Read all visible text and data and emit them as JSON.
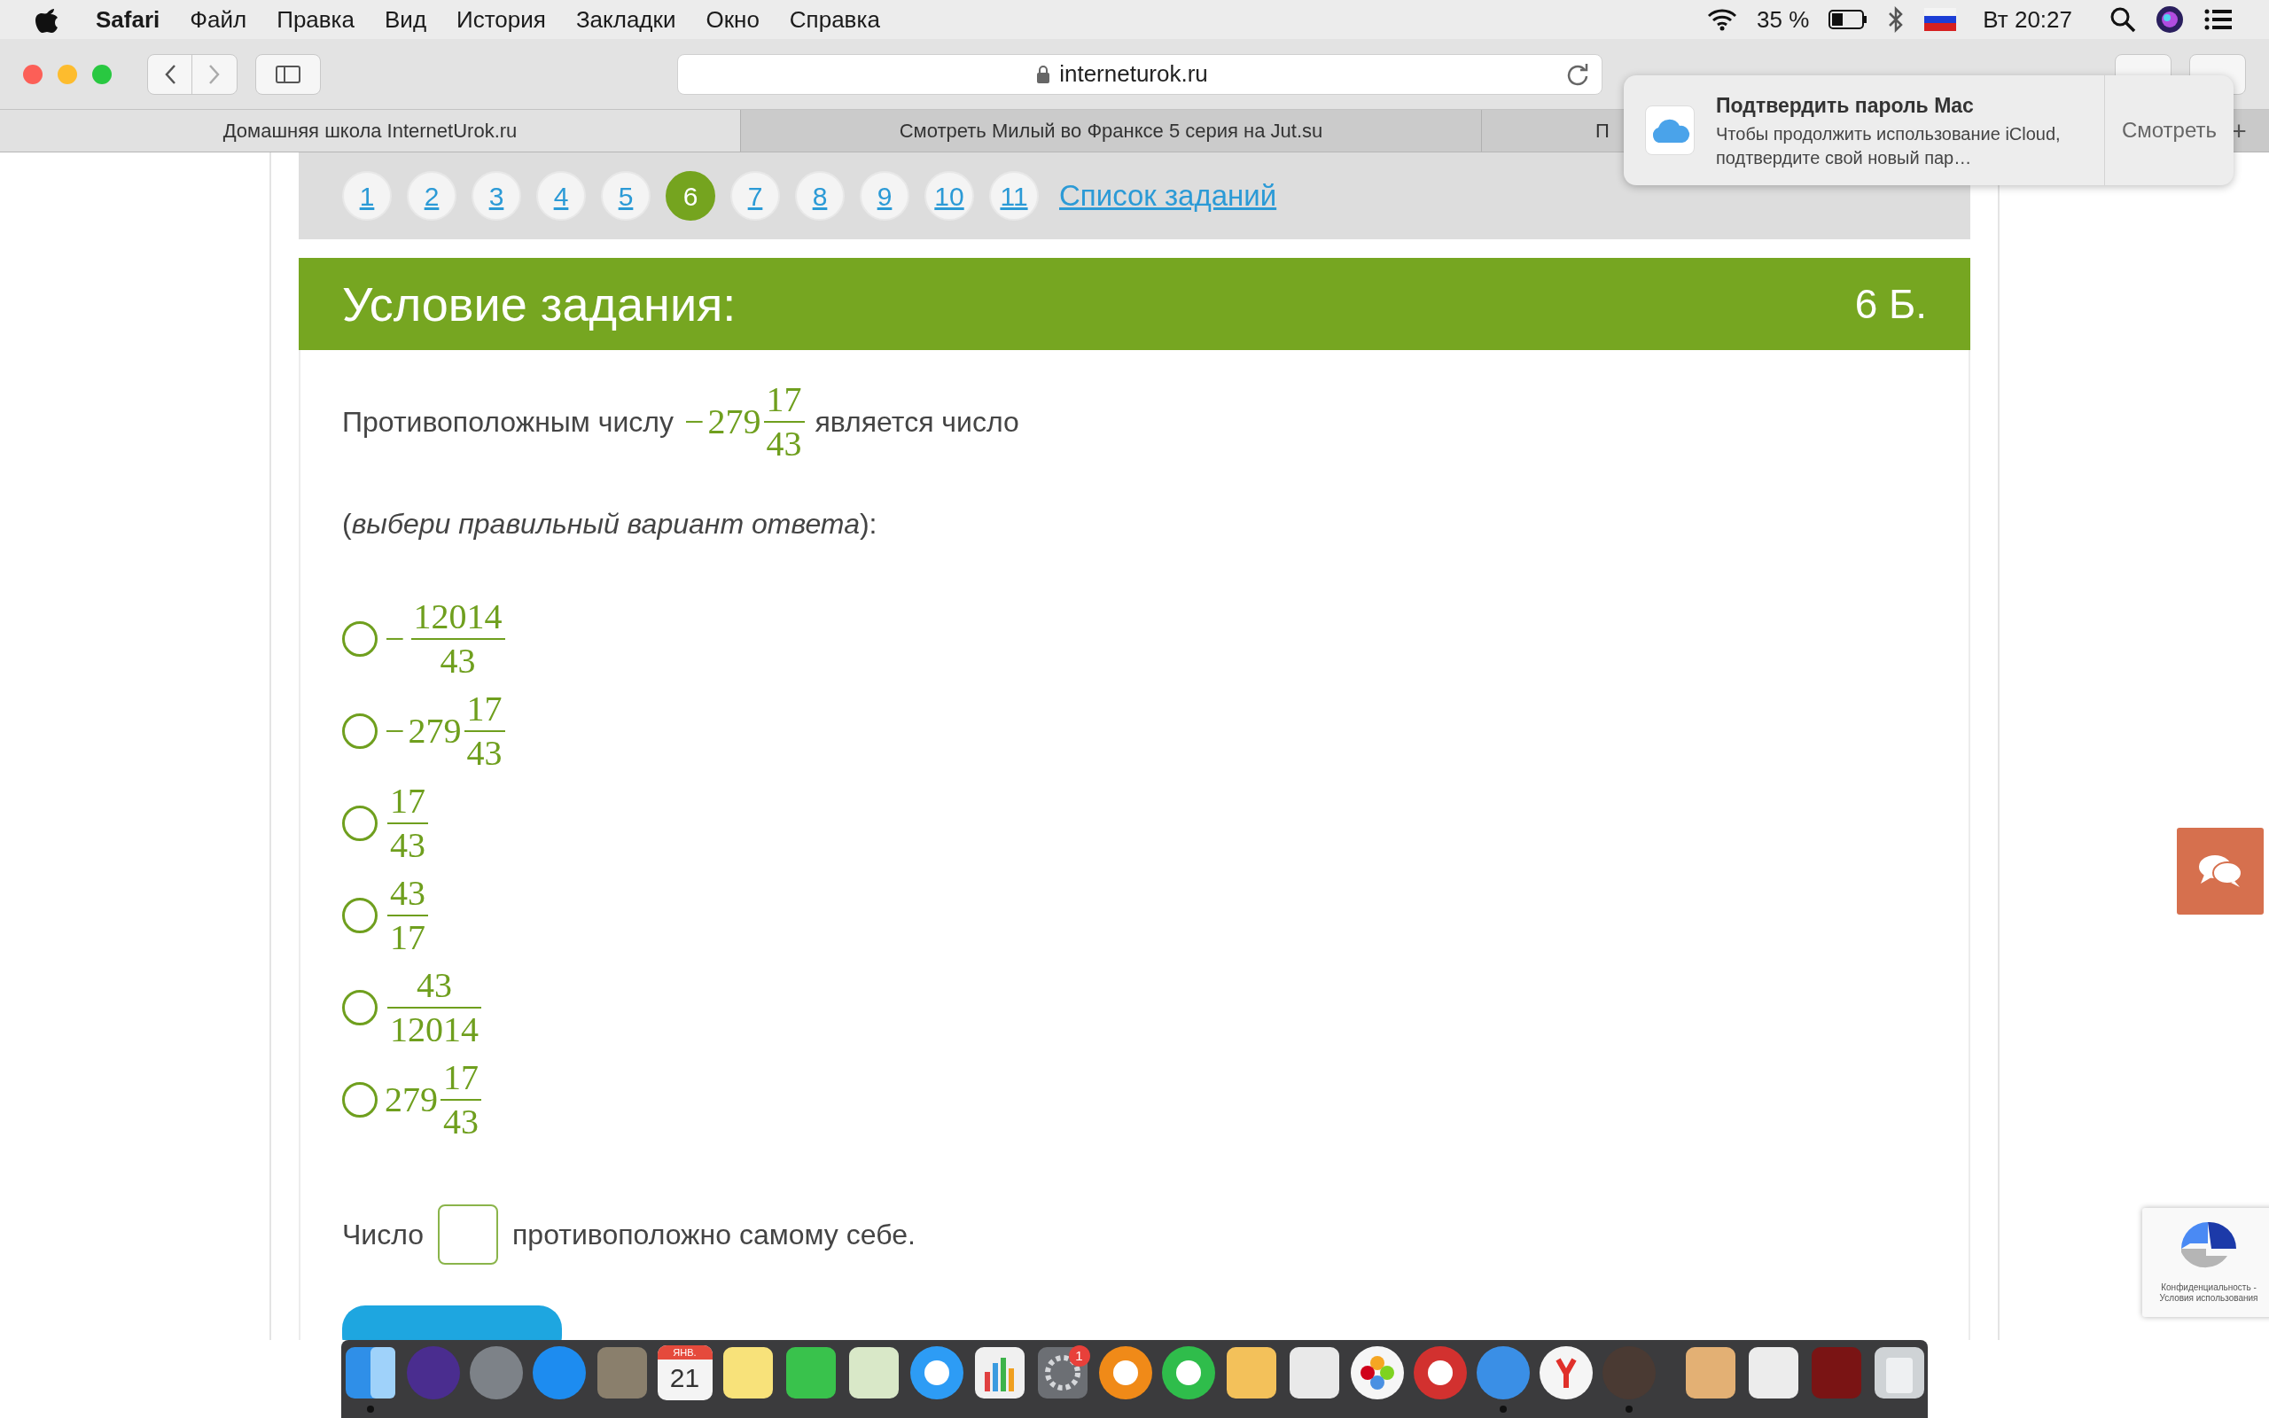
{
  "menu_bar": {
    "app": "Safari",
    "menus": [
      "Файл",
      "Правка",
      "Вид",
      "История",
      "Закладки",
      "Окно",
      "Справка"
    ],
    "battery_percent": "35 %",
    "clock": "Вт 20:27"
  },
  "toolbar": {
    "address": "interneturok.ru"
  },
  "tabs": [
    {
      "label": "Домашняя школа InternetUrok.ru",
      "selected": true
    },
    {
      "label": "Смотреть Милый во Франксе 5 серия на Jut.su",
      "selected": false
    },
    {
      "label": "П",
      "selected": false
    }
  ],
  "new_tab": "+",
  "notification": {
    "title": "Подтвердить пароль Mac",
    "body": "Чтобы продолжить использование iCloud, подтвердите свой новый пар…",
    "action": "Смотреть"
  },
  "pagination": {
    "pages": [
      {
        "label": "1",
        "selected": false
      },
      {
        "label": "2",
        "selected": false
      },
      {
        "label": "3",
        "selected": false
      },
      {
        "label": "4",
        "selected": false
      },
      {
        "label": "5",
        "selected": false
      },
      {
        "label": "6",
        "selected": true
      },
      {
        "label": "7",
        "selected": false
      },
      {
        "label": "8",
        "selected": false
      },
      {
        "label": "9",
        "selected": false
      },
      {
        "label": "10",
        "selected": false
      },
      {
        "label": "11",
        "selected": false
      }
    ],
    "list_link": "Список заданий"
  },
  "task": {
    "title": "Условие задания:",
    "points": "6 Б.",
    "question_before": "Противоположным числу",
    "question_number": {
      "sign": "−",
      "whole": "279",
      "numerator": "17",
      "denominator": "43"
    },
    "question_after": "является число",
    "instruction": "(*выбери правильный вариант ответа*):",
    "options": [
      {
        "selected": false,
        "sign": "−",
        "numerator": "12014",
        "denominator": "43"
      },
      {
        "selected": false,
        "sign": "−",
        "whole": "279",
        "numerator": "17",
        "denominator": "43"
      },
      {
        "selected": false,
        "numerator": "17",
        "denominator": "43"
      },
      {
        "selected": false,
        "numerator": "43",
        "denominator": "17"
      },
      {
        "selected": false,
        "numerator": "43",
        "denominator": "12014"
      },
      {
        "selected": false,
        "whole": "279",
        "numerator": "17",
        "denominator": "43"
      }
    ],
    "fill_before": "Число",
    "fill_after": "противоположно самому себе."
  },
  "recaptcha": {
    "links": "Конфиденциальность - Условия использования"
  },
  "dock": {
    "items": [
      {
        "running": true
      },
      {
        "running": false
      },
      {
        "running": false
      },
      {
        "running": false
      },
      {
        "running": false
      },
      {
        "running": false,
        "month": "ЯНВ.",
        "day": "21"
      },
      {
        "running": false
      },
      {
        "running": false
      },
      {
        "running": false
      },
      {
        "running": false
      },
      {
        "running": false
      },
      {
        "running": false,
        "badge": "1"
      },
      {
        "running": false
      },
      {
        "running": false
      },
      {
        "running": false
      },
      {
        "running": false
      },
      {
        "running": false
      },
      {
        "running": false
      },
      {
        "running": true
      },
      {
        "running": false
      },
      {
        "running": true
      },
      {
        "running": false
      },
      {
        "running": false
      },
      {
        "running": false
      },
      {
        "running": false
      }
    ]
  }
}
